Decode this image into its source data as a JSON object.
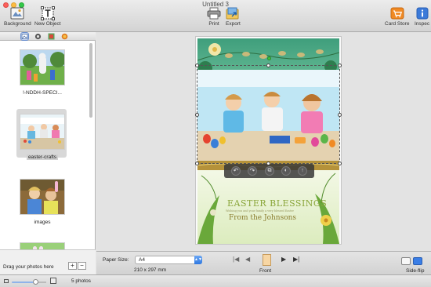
{
  "window": {
    "title": "Untitled 3"
  },
  "toolbar": {
    "background_label": "Background",
    "new_object_label": "New Object",
    "print_label": "Print",
    "export_label": "Export",
    "card_store_label": "Card Store",
    "inspector_label": "Inspec"
  },
  "sidebar": {
    "tabs": [
      "photos-tab",
      "media-tab",
      "image-tab",
      "color-tab"
    ],
    "photos": [
      {
        "caption": "!-NDDH-SPECI..."
      },
      {
        "caption": "easter-crafts",
        "selected": true
      },
      {
        "caption": "images"
      },
      {
        "caption": ""
      }
    ],
    "drag_hint": "Drag your photos here",
    "add_label": "+",
    "remove_label": "−"
  },
  "card": {
    "title": "EASTER BLESSINGS",
    "subtitle": "Wishing you and your family a very blessed Easter",
    "signature": "From the Johnsons",
    "colors": {
      "title": "#8aa63a",
      "signature": "#8a7c2e",
      "band": "#b5923a"
    }
  },
  "bottom": {
    "paper_size_label": "Paper Size:",
    "paper_size_value": "A4",
    "paper_dims": "210 x 297 mm",
    "page_label": "Front",
    "side_flip_label": "Side-flip"
  },
  "status": {
    "photo_count": "5 photos"
  }
}
